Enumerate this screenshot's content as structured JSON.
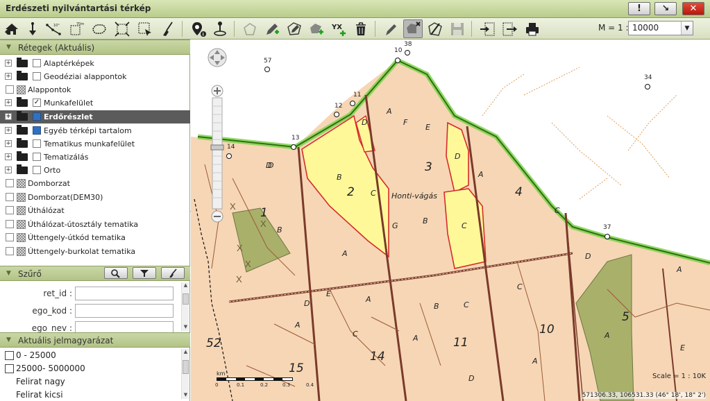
{
  "window": {
    "title": "Erdészeti nyilvántartási térkép",
    "btn_alert": "!",
    "btn_restore": "↘",
    "btn_close": "✕"
  },
  "toolbar": {
    "icons": [
      "home-icon",
      "pan-down-icon",
      "measure-line-icon",
      "zoom-box-icon",
      "area-select-icon",
      "extent-icon",
      "select-box-icon",
      "broom-icon",
      "info-pin-icon",
      "locate-icon",
      "polygon-icon",
      "pencil-add-icon",
      "edit-shape-icon",
      "poly-edit-icon",
      "yx-add-icon",
      "trash-icon",
      "pen-icon",
      "delete-shape-icon",
      "split-icon",
      "save-icon",
      "export-icon",
      "import-icon",
      "print-icon"
    ],
    "scale_label": "M = 1 :",
    "scale_value": "10000"
  },
  "layers_panel": {
    "header": "Rétegek (Aktuális)",
    "items": [
      {
        "label": "Alaptérképek",
        "type": "folder",
        "checked": false
      },
      {
        "label": "Geodéziai alappontok",
        "type": "folder",
        "checked": false
      },
      {
        "label": "Alappontok",
        "type": "item"
      },
      {
        "label": "Munkafelület",
        "type": "folder",
        "checked": true
      },
      {
        "label": "Erdőrészlet",
        "type": "folder",
        "selected": true
      },
      {
        "label": "Egyéb térképi tartalom",
        "type": "folder",
        "filled": true
      },
      {
        "label": "Tematikus munkafelület",
        "type": "folder",
        "checked": false
      },
      {
        "label": "Tematizálás",
        "type": "folder",
        "checked": false
      },
      {
        "label": "Orto",
        "type": "folder",
        "checked": false
      },
      {
        "label": "Domborzat",
        "type": "item"
      },
      {
        "label": "Domborzat(DEM30)",
        "type": "item"
      },
      {
        "label": "Úthálózat",
        "type": "item"
      },
      {
        "label": "Úthálózat-útosztály tematika",
        "type": "item"
      },
      {
        "label": "Úttengely-útkód tematika",
        "type": "item"
      },
      {
        "label": "Úttengely-burkolat tematika",
        "type": "item"
      }
    ]
  },
  "filter_panel": {
    "header": "Szűrő",
    "fields": [
      {
        "label": "ret_id :",
        "value": ""
      },
      {
        "label": "ego_kod :",
        "value": ""
      },
      {
        "label": "ego_nev :",
        "value": ""
      }
    ]
  },
  "legend_panel": {
    "header": "Aktuális jelmagyarázat",
    "items": [
      "0 - 25000",
      "25000- 5000000",
      "Felirat nagy",
      "Felirat kicsi"
    ]
  },
  "map": {
    "place_name": "Honti-vágás",
    "scale_text": "Scale = 1 : 10K",
    "coordinates": "571306.33, 106531.33 (46° 18', 18° 2')",
    "scalebar_unit": "km",
    "scalebar_ticks": [
      "0",
      "0.1",
      "0.2",
      "0.3",
      "0.4"
    ],
    "compartments": [
      "1",
      "2",
      "3",
      "4",
      "5",
      "10",
      "11",
      "14",
      "15",
      "52"
    ],
    "subcompartments": [
      "A",
      "B",
      "C",
      "D",
      "E",
      "F",
      "G"
    ],
    "points": [
      "10",
      "11",
      "12",
      "13",
      "14",
      "34",
      "37",
      "38",
      "57"
    ]
  }
}
